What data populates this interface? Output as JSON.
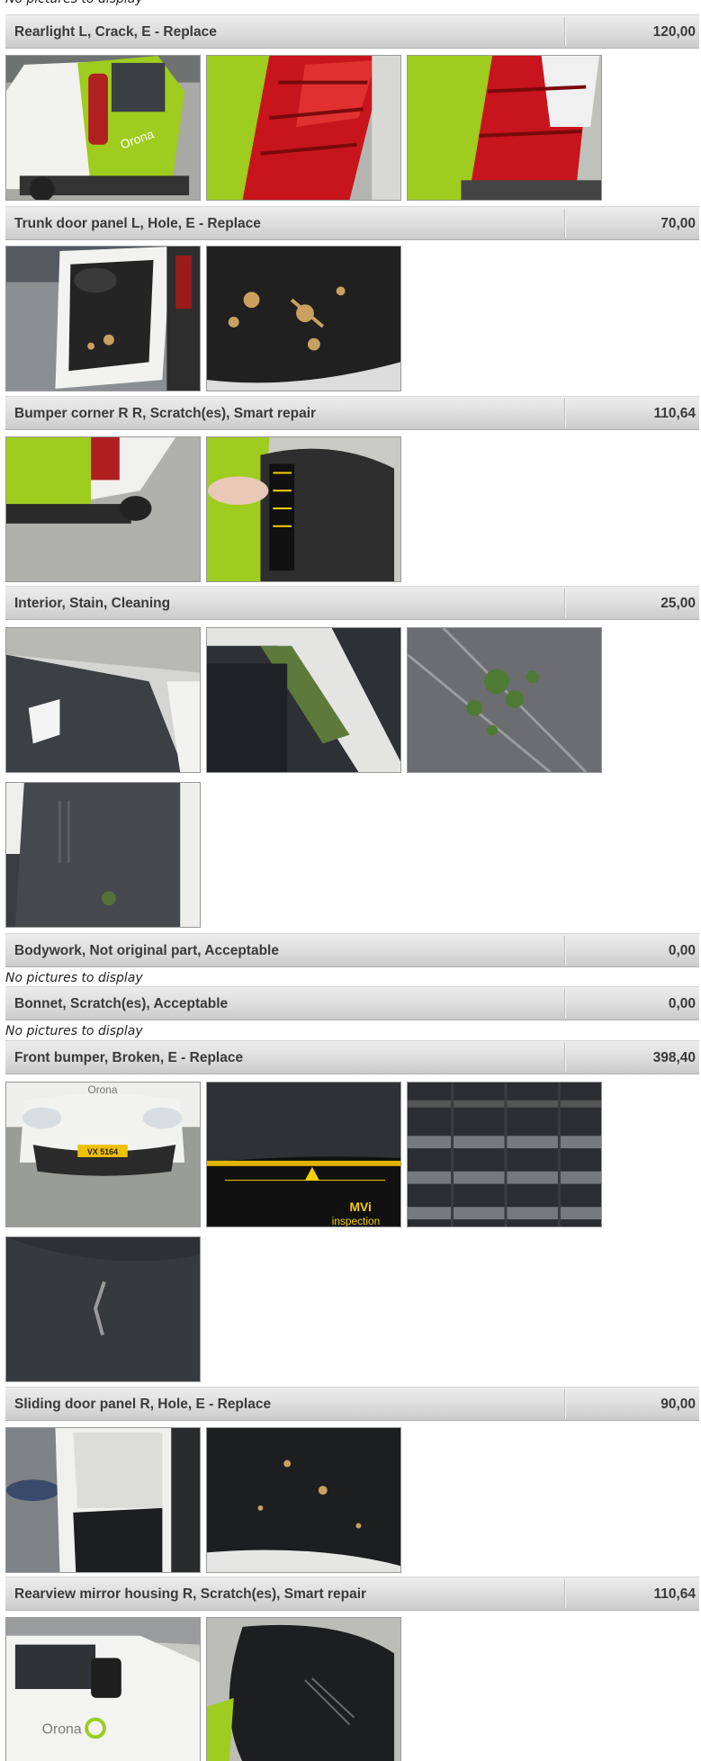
{
  "no_pictures_text": "No pictures to display",
  "damages": [
    {
      "title": "Rearlight L, Crack, E - Replace",
      "amount": "120,00",
      "photos": [
        "van-rear-green",
        "rearlight-closeup",
        "rearlight-closeup-2"
      ]
    },
    {
      "title": "Trunk door panel L, Hole, E - Replace",
      "amount": "70,00",
      "photos": [
        "trunk-door-open",
        "door-panel-damage"
      ]
    },
    {
      "title": "Bumper corner R R, Scratch(es), Smart repair",
      "amount": "110,64",
      "photos": [
        "rear-bumper-corner",
        "bumper-measure"
      ]
    },
    {
      "title": "Interior, Stain, Cleaning",
      "amount": "25,00",
      "photos": [
        "interior-cargo",
        "interior-roof-stain",
        "interior-panel-stain",
        "interior-side-wall"
      ]
    },
    {
      "title": "Bodywork, Not original part, Acceptable",
      "amount": "0,00",
      "photos": []
    },
    {
      "title": "Bonnet, Scratch(es), Acceptable",
      "amount": "0,00",
      "photos": []
    },
    {
      "title": "Front bumper, Broken, E - Replace",
      "amount": "398,40",
      "photos": [
        "front-bumper-plate",
        "front-bumper-measure",
        "front-grille",
        "front-bumper-crack"
      ]
    },
    {
      "title": "Sliding door panel R, Hole, E - Replace",
      "amount": "90,00",
      "photos": [
        "sliding-door-open",
        "sliding-door-panel"
      ]
    },
    {
      "title": "Rearview mirror housing R, Scratch(es), Smart repair",
      "amount": "110,64",
      "photos": [
        "mirror-van-side",
        "mirror-scratch"
      ]
    }
  ],
  "plate_text": "VX 5164",
  "brand_text": "Orona",
  "tape_brand_text": "MVi",
  "tape_caption_text": "inspection"
}
